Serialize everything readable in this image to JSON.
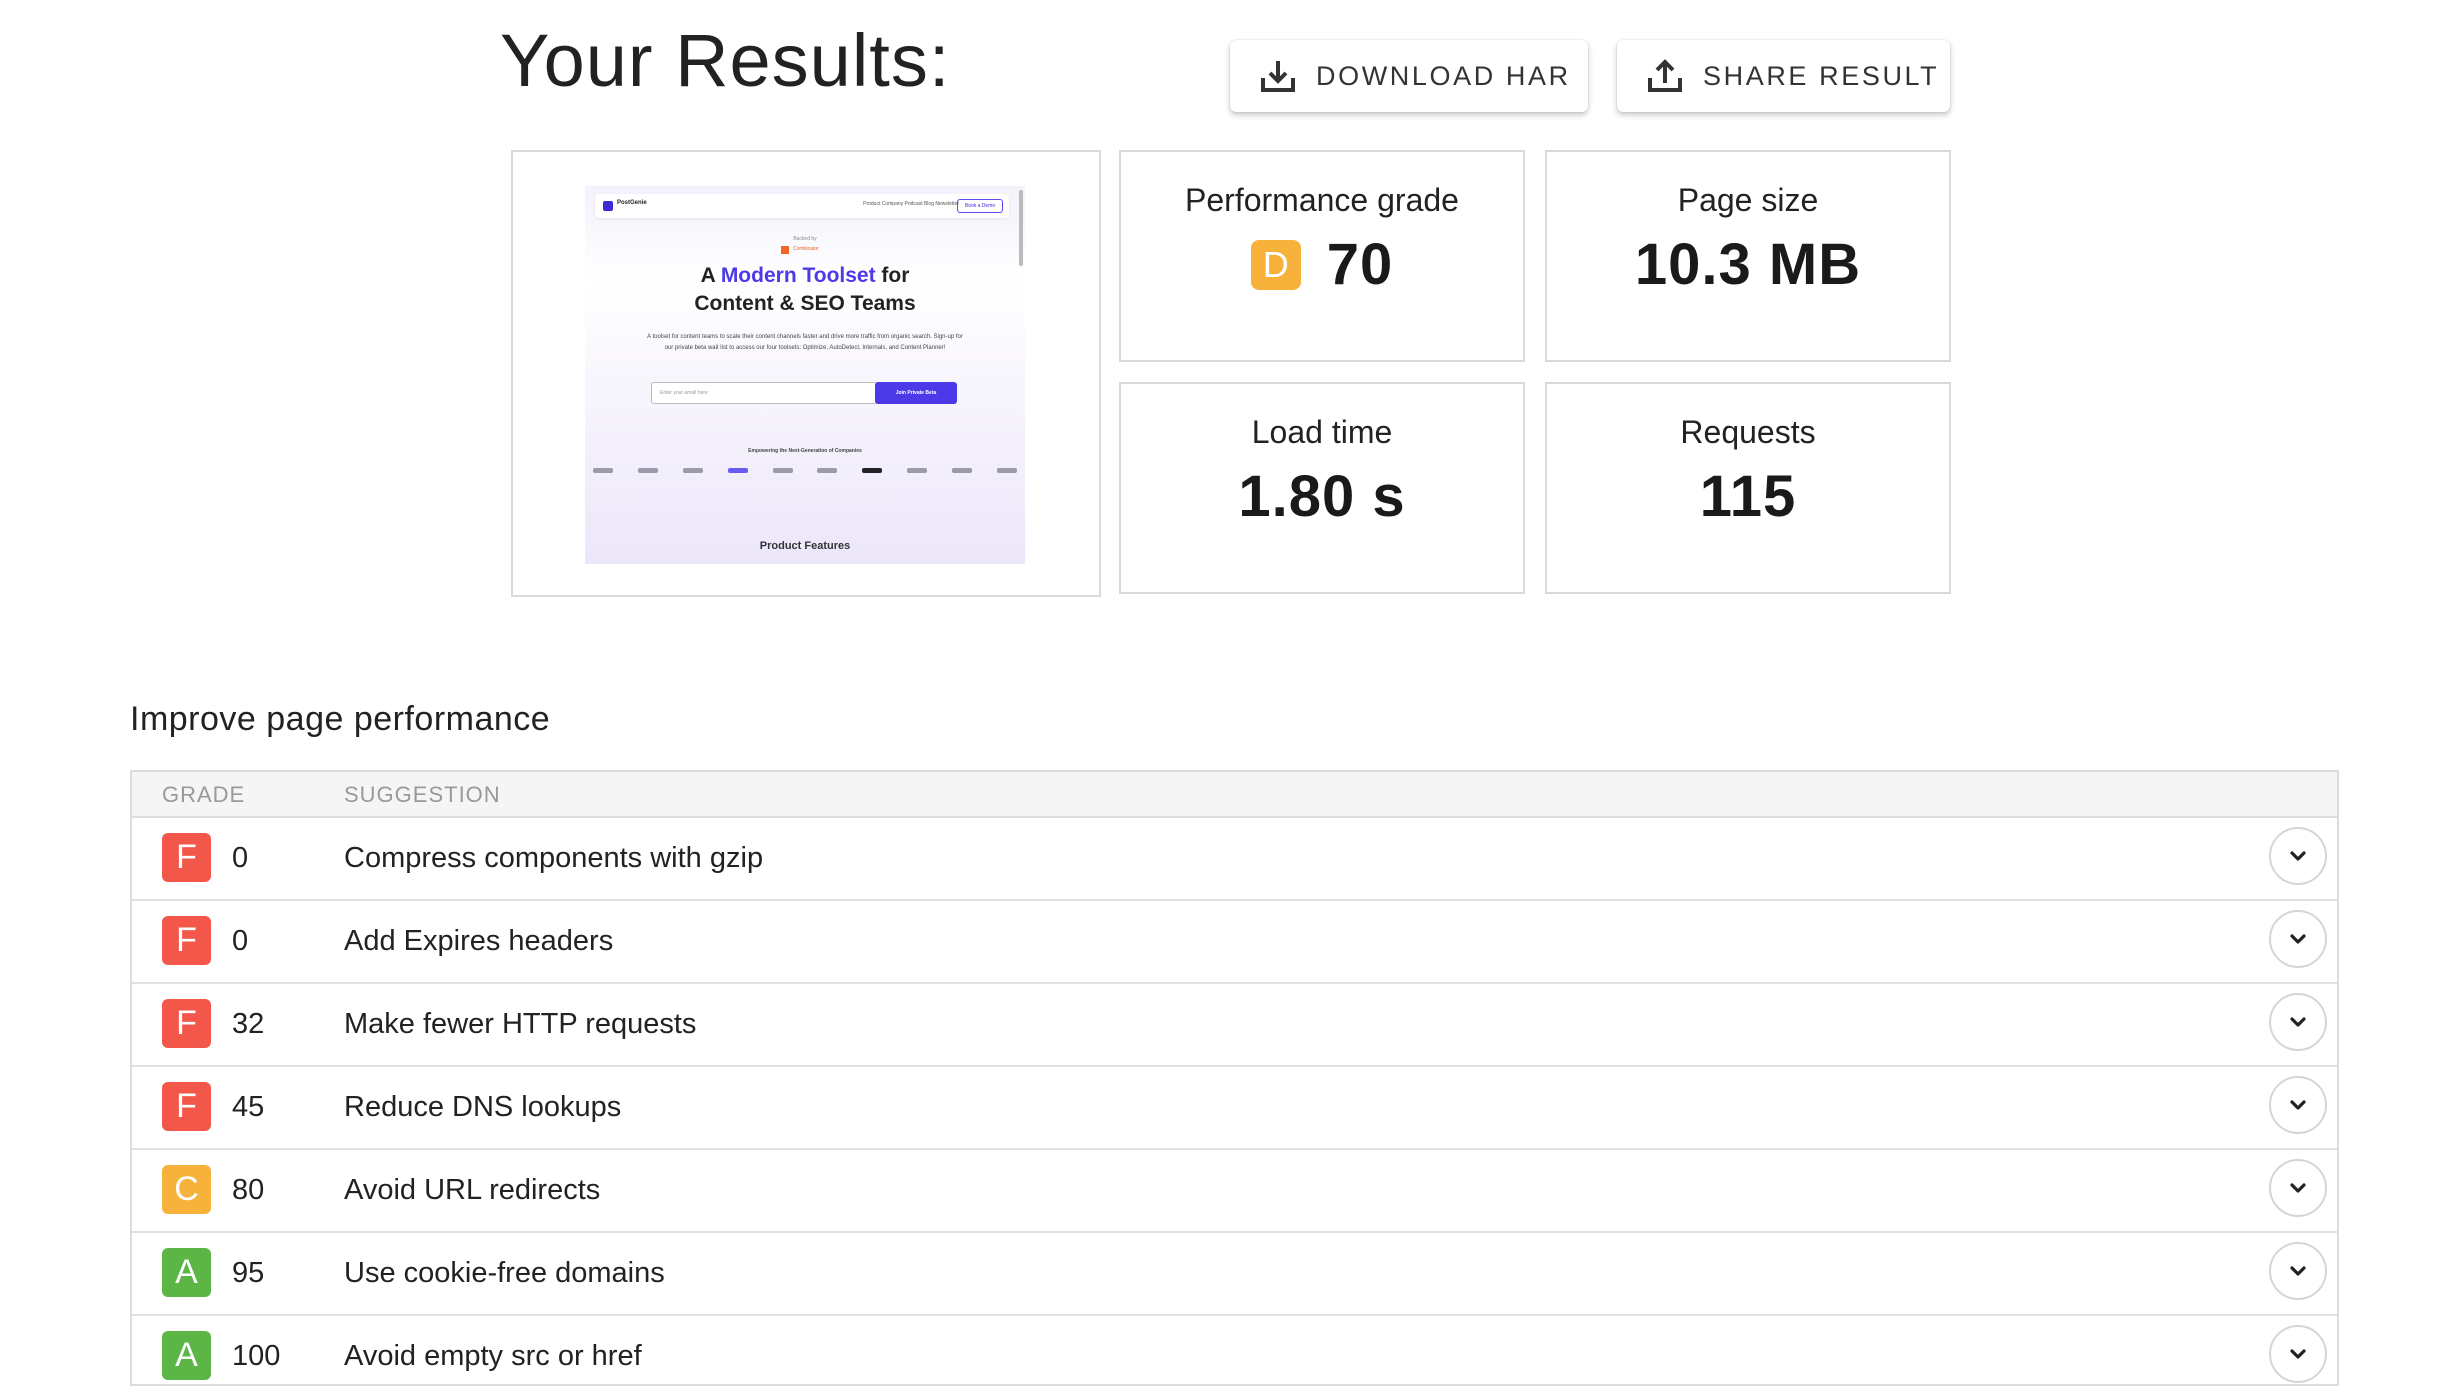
{
  "header": {
    "title": "Your Results:",
    "download_label": "DOWNLOAD HAR",
    "share_label": "SHARE RESULT"
  },
  "metrics": {
    "performance": {
      "label": "Performance grade",
      "grade": "D",
      "value": "70",
      "color": "#f7b23b"
    },
    "page_size": {
      "label": "Page size",
      "value": "10.3 MB"
    },
    "load_time": {
      "label": "Load time",
      "value": "1.80 s"
    },
    "requests": {
      "label": "Requests",
      "value": "115"
    }
  },
  "thumbnail": {
    "logo_text": "PostGenie",
    "nav_links": "Product  Company  Podcast  Blog  Newsletter",
    "nav_button": "Book a Demo",
    "backed_by": "Backed by",
    "yc_label": "Combinator",
    "headline_1": "A ",
    "headline_accent": "Modern Toolset",
    "headline_2": " for",
    "headline_line2": "Content & SEO Teams",
    "subtext": "A toolset for content teams to scale their content channels faster and drive more traffic from organic search. Sign-up for our private beta wait list to access our four toolsets: Optimize, AutoDetect, Internals, and Content Planner!",
    "email_placeholder": "Enter your email here",
    "join_button": "Join Private Beta",
    "empowering": "Empowering the Next-Generation of Companies",
    "product_features": "Product Features"
  },
  "improve": {
    "title": "Improve page performance",
    "col_grade": "GRADE",
    "col_suggestion": "SUGGESTION",
    "rows": [
      {
        "grade": "F",
        "score": "0",
        "suggestion": "Compress components with gzip",
        "color": "#f2574a"
      },
      {
        "grade": "F",
        "score": "0",
        "suggestion": "Add Expires headers",
        "color": "#f2574a"
      },
      {
        "grade": "F",
        "score": "32",
        "suggestion": "Make fewer HTTP requests",
        "color": "#f2574a"
      },
      {
        "grade": "F",
        "score": "45",
        "suggestion": "Reduce DNS lookups",
        "color": "#f2574a"
      },
      {
        "grade": "C",
        "score": "80",
        "suggestion": "Avoid URL redirects",
        "color": "#f7b23b"
      },
      {
        "grade": "A",
        "score": "95",
        "suggestion": "Use cookie-free domains",
        "color": "#5bb646"
      },
      {
        "grade": "A",
        "score": "100",
        "suggestion": "Avoid empty src or href",
        "color": "#5bb646"
      }
    ]
  },
  "icons": {
    "download": "download-icon",
    "share": "share-icon",
    "expand": "chevron-down-icon"
  }
}
